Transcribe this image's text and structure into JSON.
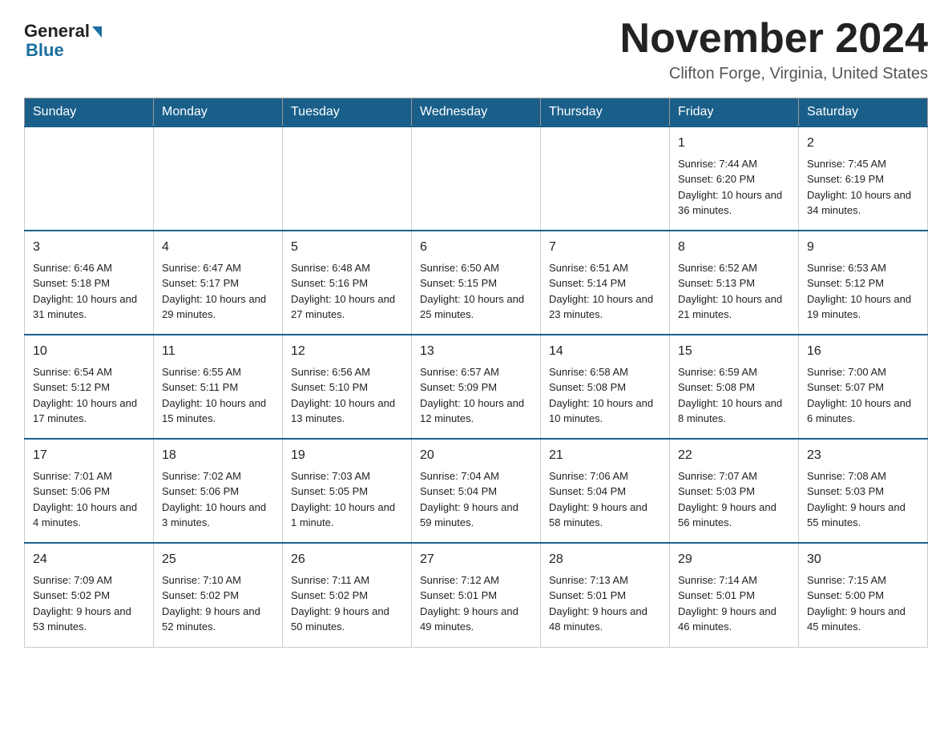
{
  "logo": {
    "general_text": "General",
    "blue_text": "Blue"
  },
  "header": {
    "month_title": "November 2024",
    "location": "Clifton Forge, Virginia, United States"
  },
  "days_of_week": [
    "Sunday",
    "Monday",
    "Tuesday",
    "Wednesday",
    "Thursday",
    "Friday",
    "Saturday"
  ],
  "weeks": [
    [
      {
        "day": "",
        "sunrise": "",
        "sunset": "",
        "daylight": ""
      },
      {
        "day": "",
        "sunrise": "",
        "sunset": "",
        "daylight": ""
      },
      {
        "day": "",
        "sunrise": "",
        "sunset": "",
        "daylight": ""
      },
      {
        "day": "",
        "sunrise": "",
        "sunset": "",
        "daylight": ""
      },
      {
        "day": "",
        "sunrise": "",
        "sunset": "",
        "daylight": ""
      },
      {
        "day": "1",
        "sunrise": "Sunrise: 7:44 AM",
        "sunset": "Sunset: 6:20 PM",
        "daylight": "Daylight: 10 hours and 36 minutes."
      },
      {
        "day": "2",
        "sunrise": "Sunrise: 7:45 AM",
        "sunset": "Sunset: 6:19 PM",
        "daylight": "Daylight: 10 hours and 34 minutes."
      }
    ],
    [
      {
        "day": "3",
        "sunrise": "Sunrise: 6:46 AM",
        "sunset": "Sunset: 5:18 PM",
        "daylight": "Daylight: 10 hours and 31 minutes."
      },
      {
        "day": "4",
        "sunrise": "Sunrise: 6:47 AM",
        "sunset": "Sunset: 5:17 PM",
        "daylight": "Daylight: 10 hours and 29 minutes."
      },
      {
        "day": "5",
        "sunrise": "Sunrise: 6:48 AM",
        "sunset": "Sunset: 5:16 PM",
        "daylight": "Daylight: 10 hours and 27 minutes."
      },
      {
        "day": "6",
        "sunrise": "Sunrise: 6:50 AM",
        "sunset": "Sunset: 5:15 PM",
        "daylight": "Daylight: 10 hours and 25 minutes."
      },
      {
        "day": "7",
        "sunrise": "Sunrise: 6:51 AM",
        "sunset": "Sunset: 5:14 PM",
        "daylight": "Daylight: 10 hours and 23 minutes."
      },
      {
        "day": "8",
        "sunrise": "Sunrise: 6:52 AM",
        "sunset": "Sunset: 5:13 PM",
        "daylight": "Daylight: 10 hours and 21 minutes."
      },
      {
        "day": "9",
        "sunrise": "Sunrise: 6:53 AM",
        "sunset": "Sunset: 5:12 PM",
        "daylight": "Daylight: 10 hours and 19 minutes."
      }
    ],
    [
      {
        "day": "10",
        "sunrise": "Sunrise: 6:54 AM",
        "sunset": "Sunset: 5:12 PM",
        "daylight": "Daylight: 10 hours and 17 minutes."
      },
      {
        "day": "11",
        "sunrise": "Sunrise: 6:55 AM",
        "sunset": "Sunset: 5:11 PM",
        "daylight": "Daylight: 10 hours and 15 minutes."
      },
      {
        "day": "12",
        "sunrise": "Sunrise: 6:56 AM",
        "sunset": "Sunset: 5:10 PM",
        "daylight": "Daylight: 10 hours and 13 minutes."
      },
      {
        "day": "13",
        "sunrise": "Sunrise: 6:57 AM",
        "sunset": "Sunset: 5:09 PM",
        "daylight": "Daylight: 10 hours and 12 minutes."
      },
      {
        "day": "14",
        "sunrise": "Sunrise: 6:58 AM",
        "sunset": "Sunset: 5:08 PM",
        "daylight": "Daylight: 10 hours and 10 minutes."
      },
      {
        "day": "15",
        "sunrise": "Sunrise: 6:59 AM",
        "sunset": "Sunset: 5:08 PM",
        "daylight": "Daylight: 10 hours and 8 minutes."
      },
      {
        "day": "16",
        "sunrise": "Sunrise: 7:00 AM",
        "sunset": "Sunset: 5:07 PM",
        "daylight": "Daylight: 10 hours and 6 minutes."
      }
    ],
    [
      {
        "day": "17",
        "sunrise": "Sunrise: 7:01 AM",
        "sunset": "Sunset: 5:06 PM",
        "daylight": "Daylight: 10 hours and 4 minutes."
      },
      {
        "day": "18",
        "sunrise": "Sunrise: 7:02 AM",
        "sunset": "Sunset: 5:06 PM",
        "daylight": "Daylight: 10 hours and 3 minutes."
      },
      {
        "day": "19",
        "sunrise": "Sunrise: 7:03 AM",
        "sunset": "Sunset: 5:05 PM",
        "daylight": "Daylight: 10 hours and 1 minute."
      },
      {
        "day": "20",
        "sunrise": "Sunrise: 7:04 AM",
        "sunset": "Sunset: 5:04 PM",
        "daylight": "Daylight: 9 hours and 59 minutes."
      },
      {
        "day": "21",
        "sunrise": "Sunrise: 7:06 AM",
        "sunset": "Sunset: 5:04 PM",
        "daylight": "Daylight: 9 hours and 58 minutes."
      },
      {
        "day": "22",
        "sunrise": "Sunrise: 7:07 AM",
        "sunset": "Sunset: 5:03 PM",
        "daylight": "Daylight: 9 hours and 56 minutes."
      },
      {
        "day": "23",
        "sunrise": "Sunrise: 7:08 AM",
        "sunset": "Sunset: 5:03 PM",
        "daylight": "Daylight: 9 hours and 55 minutes."
      }
    ],
    [
      {
        "day": "24",
        "sunrise": "Sunrise: 7:09 AM",
        "sunset": "Sunset: 5:02 PM",
        "daylight": "Daylight: 9 hours and 53 minutes."
      },
      {
        "day": "25",
        "sunrise": "Sunrise: 7:10 AM",
        "sunset": "Sunset: 5:02 PM",
        "daylight": "Daylight: 9 hours and 52 minutes."
      },
      {
        "day": "26",
        "sunrise": "Sunrise: 7:11 AM",
        "sunset": "Sunset: 5:02 PM",
        "daylight": "Daylight: 9 hours and 50 minutes."
      },
      {
        "day": "27",
        "sunrise": "Sunrise: 7:12 AM",
        "sunset": "Sunset: 5:01 PM",
        "daylight": "Daylight: 9 hours and 49 minutes."
      },
      {
        "day": "28",
        "sunrise": "Sunrise: 7:13 AM",
        "sunset": "Sunset: 5:01 PM",
        "daylight": "Daylight: 9 hours and 48 minutes."
      },
      {
        "day": "29",
        "sunrise": "Sunrise: 7:14 AM",
        "sunset": "Sunset: 5:01 PM",
        "daylight": "Daylight: 9 hours and 46 minutes."
      },
      {
        "day": "30",
        "sunrise": "Sunrise: 7:15 AM",
        "sunset": "Sunset: 5:00 PM",
        "daylight": "Daylight: 9 hours and 45 minutes."
      }
    ]
  ]
}
